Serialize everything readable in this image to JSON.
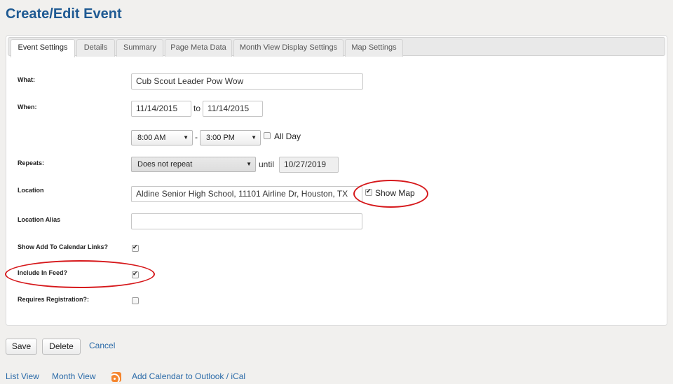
{
  "page": {
    "title": "Create/Edit Event"
  },
  "tabs": [
    {
      "label": "Event Settings"
    },
    {
      "label": "Details"
    },
    {
      "label": "Summary"
    },
    {
      "label": "Page Meta Data"
    },
    {
      "label": "Month View Display Settings"
    },
    {
      "label": "Map Settings"
    }
  ],
  "form": {
    "what": {
      "label": "What:",
      "value": "Cub Scout Leader Pow Wow"
    },
    "when": {
      "label": "When:",
      "start_date": "11/14/2015",
      "to": "to",
      "end_date": "11/14/2015",
      "start_time": "8:00 AM",
      "dash": "-",
      "end_time": "3:00 PM",
      "all_day_label": "All Day",
      "all_day_checked": false
    },
    "repeats": {
      "label": "Repeats:",
      "value": "Does not repeat",
      "until": "until",
      "until_date": "10/27/2019"
    },
    "location": {
      "label": "Location",
      "value": "Aldine Senior High School, 11101 Airline Dr, Houston, TX",
      "show_map_label": "Show Map",
      "show_map_checked": true
    },
    "location_alias": {
      "label": "Location Alias",
      "value": ""
    },
    "show_add_to_calendar": {
      "label": "Show Add To Calendar Links?",
      "checked": true
    },
    "include_in_feed": {
      "label": "Include In Feed?",
      "checked": true
    },
    "requires_registration": {
      "label": "Requires Registration?:",
      "checked": false
    }
  },
  "actions": {
    "save": "Save",
    "delete": "Delete",
    "cancel": "Cancel"
  },
  "footer": {
    "list_view": "List View",
    "month_view": "Month View",
    "rss_icon": "rss-feed-icon",
    "add_calendar": "Add Calendar to Outlook / iCal"
  },
  "colors": {
    "title": "#1f5a93",
    "link": "#2a6aa8",
    "annotation_ring": "#d6181b",
    "rss": "#f5852d"
  }
}
